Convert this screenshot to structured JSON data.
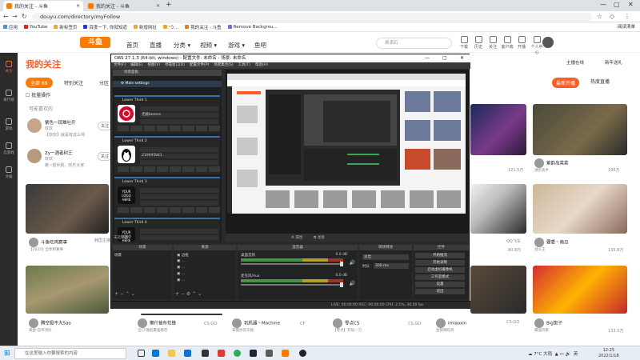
{
  "browser": {
    "tabs": [
      {
        "label": "我的关注 - 斗鱼",
        "active": true
      },
      {
        "label": "我的关注 - 斗鱼",
        "active": false
      }
    ],
    "new_tab_glyph": "+",
    "url": "douyu.com/directory/myFollow",
    "bookmarks": [
      "应用",
      "YouTube",
      "新标签页",
      "百度一下, 你就知道",
      "新增网址",
      "'う...",
      "我的关注 - 斗鱼",
      "Remove Backgrou..."
    ],
    "reading_list": "阅读清单"
  },
  "douyu": {
    "logo": "斗鱼",
    "nav": [
      "首页",
      "直播",
      "分类 ▾",
      "视频 ▾",
      "游戏 ▾",
      "鱼吧"
    ],
    "search_placeholder": "鼻滴石",
    "header_icons": [
      "下载",
      "历史",
      "关注",
      "客户端",
      "开播",
      "个人中心"
    ],
    "left_items": [
      "关注",
      "排行榜",
      "游戏",
      "云游戏",
      "文娱"
    ],
    "page_title": "我的关注",
    "subtabs": [
      {
        "label": "全部 69",
        "on": true
      },
      {
        "label": "特别关注",
        "on": false
      },
      {
        "label": "分区",
        "on": false
      }
    ],
    "batch_label": "批量操作",
    "section_label": "可能喜欢的",
    "anchors": [
      {
        "name": "紫色一现难吐开",
        "sub": "欢欢",
        "desc": "【欢欢】就是有这么帅",
        "follow": "关注"
      },
      {
        "name": "Zy一酒者树王",
        "sub": "欢欢",
        "desc": "跳~悦手我、欢乐大家",
        "follow": "关注"
      }
    ],
    "right_ctrl": "主播在线",
    "right_ctrl2": "新年送礼",
    "hot_btn": "最新开播",
    "hot_btn2": "热度直播",
    "cards": [
      {
        "name": "斗鱼吃鸡赛事",
        "sub": "【2022】全体积赛事"
      },
      {
        "name": "腾空极不大Sao",
        "sub": "黄金-自带顶好"
      },
      {
        "name": "懒什被布花蜂",
        "sub": "全CF激起最强模范"
      },
      {
        "name": "玩机器丶Machine",
        "sub": "掌握你的天赋"
      },
      {
        "name": "零点CS",
        "sub": "【零点】开局一刀"
      },
      {
        "name": "imiaoxin",
        "sub": "金银铜吃鸡"
      },
      {
        "name": "Big斑子",
        "sub": "最强玩家"
      },
      {
        "name": "紫韵岛菜菜",
        "sub": "进阶高手"
      },
      {
        "name": "要委丶南瓜",
        "sub": "战斗王"
      }
    ],
    "card_counts": [
      "121.5万",
      "166万",
      "80.8万",
      "135.8万",
      "CS:GO",
      "CS:GO",
      "133.5万",
      "CF"
    ],
    "card_tags": [
      "QQ飞车",
      "CS:GO",
      "韩国主播"
    ]
  },
  "obs": {
    "title": "OBS 27.1.3 (64-bit, windows) - 配置文件: 未命名 - 场景: 未命名",
    "menu": [
      "文件(F)",
      "编辑(E)",
      "视图(V)",
      "停靠窗口(D)",
      "配置文件(P)",
      "场景集合(S)",
      "工具(T)",
      "帮助(H)"
    ],
    "scene_header": "场景面板",
    "main_settings": "Main settings",
    "lower_thirds": [
      {
        "label": "Lower Third 1",
        "line": "无敌bossss"
      },
      {
        "label": "Lower Third 2",
        "line": "219695841"
      },
      {
        "label": "Lower Third 3",
        "line": "YOUR LOGO HERE"
      },
      {
        "label": "Lower Third 4",
        "line": "YOUR LOGO HERE"
      }
    ],
    "midbar_left": "未选择源",
    "midbar_props": "属性",
    "midbar_filter": "滤镜",
    "panels": {
      "scenes": "场景",
      "sources": "来源",
      "mixer": "混音器",
      "transitions": "转场特效",
      "controls": "控件"
    },
    "scene_items": [
      "场景"
    ],
    "source_items": [
      "边框"
    ],
    "mixer_rows": [
      {
        "name": "桌面音频",
        "db": "0.0 dB"
      },
      {
        "name": "麦克风/Aux",
        "db": "0.0 dB"
      }
    ],
    "transition_fade": "淡出",
    "duration_label": "时长",
    "duration_value": "300 ms",
    "controls": [
      "开始推流",
      "开始录制",
      "启动虚拟摄像机",
      "工作室模式",
      "设置",
      "退出"
    ],
    "status": "LIVE: 00:00:00   REC: 00:00:00   CPU: 2.1%, 30.00 fps"
  },
  "taskbar": {
    "search_placeholder": "在这里输入你要搜索的内容",
    "weather": "7°C 大雨",
    "tray": "英",
    "time": "12:25",
    "date": "2022/1/18"
  },
  "colors": {
    "accent": "#ff5d23",
    "douyu_orange": "#ff7a00",
    "obs_dark": "#2a2a2a",
    "obs_blue": "#3a6ea5"
  }
}
